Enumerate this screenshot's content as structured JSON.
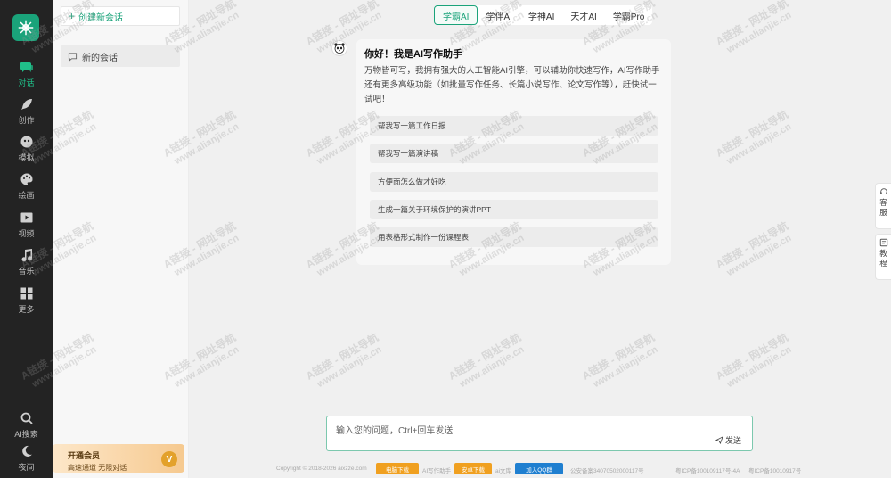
{
  "rail": {
    "items": [
      {
        "label": "对话",
        "icon": "chat-icon"
      },
      {
        "label": "创作",
        "icon": "feather-icon"
      },
      {
        "label": "模拟",
        "icon": "mask-icon"
      },
      {
        "label": "绘画",
        "icon": "palette-icon"
      },
      {
        "label": "视频",
        "icon": "video-icon"
      },
      {
        "label": "音乐",
        "icon": "music-icon"
      },
      {
        "label": "更多",
        "icon": "grid-icon"
      }
    ],
    "bottom": [
      {
        "label": "AI搜索",
        "icon": "search-icon"
      },
      {
        "label": "夜间",
        "icon": "moon-icon"
      }
    ]
  },
  "sessions": {
    "new_label": "创建新会话",
    "items": [
      "新的会话"
    ]
  },
  "vip": {
    "title": "开通会员",
    "subtitle": "高速通道 无限对话",
    "badge": "V"
  },
  "tabs": [
    "学霸AI",
    "学伴AI",
    "学神AI",
    "天才AI",
    "学霸Pro"
  ],
  "message": {
    "title": "你好！我是AI写作助手",
    "body": "万物皆可写，我拥有强大的人工智能AI引擎，可以辅助你快速写作，AI写作助手还有更多高级功能（如批量写作任务、长篇小说写作、论文写作等），赶快试一试吧！",
    "suggestions": [
      "帮我写一篇工作日报",
      "帮我写一篇演讲稿",
      "方便面怎么做才好吃",
      "生成一篇关于环境保护的演讲PPT",
      "用表格形式制作一份课程表"
    ]
  },
  "side_buttons": [
    {
      "label": "客服",
      "icon": "headset-icon"
    },
    {
      "label": "教程",
      "icon": "book-icon"
    }
  ],
  "input": {
    "placeholder": "输入您的问题，Ctrl+回车发送",
    "send_label": "发送"
  },
  "footer": {
    "copyright": "Copyright © 2018-2026 aixzze.com",
    "pc_badge": "电脑下载",
    "mid": "AI写作助手",
    "app_badge": "安卓下载",
    "lib": "ai文库",
    "qq_badge": "加入QQ群",
    "police": "公安备案34070502000117号",
    "icp1": "粤ICP备100109117号-4A",
    "icp2": "粤ICP备10010917号"
  },
  "watermark": {
    "line1": "A链接 - 网址导航",
    "line2": "www.alianjie.cn"
  },
  "colors": {
    "accent": "#1aa37a",
    "rail_bg": "#232323",
    "vip_gold": "#e3a12b"
  }
}
